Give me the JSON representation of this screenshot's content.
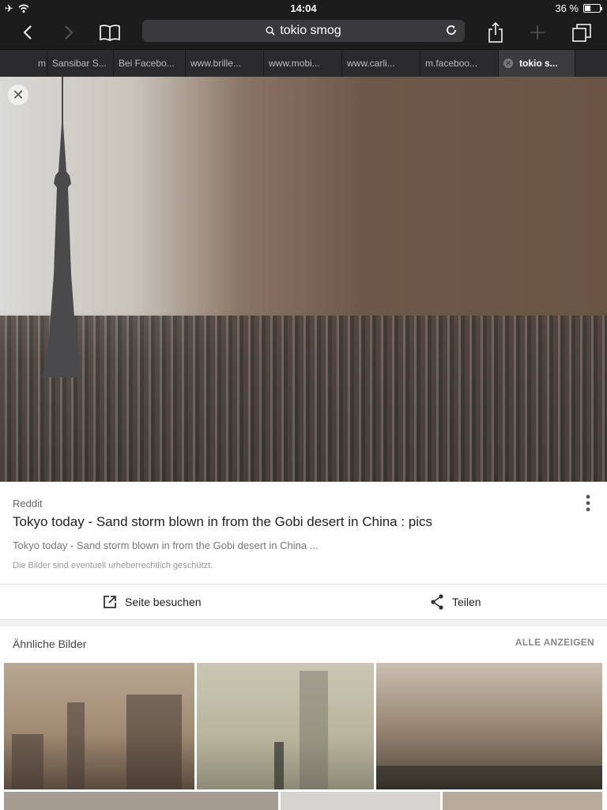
{
  "status": {
    "time": "14:04",
    "battery": "36 %",
    "battery_level": 0.36
  },
  "toolbar": {
    "url_query": "tokio smog"
  },
  "tabs": [
    {
      "label": "m.f"
    },
    {
      "label": "Sansibar S..."
    },
    {
      "label": "Bei Facebo..."
    },
    {
      "label": "www.brille..."
    },
    {
      "label": "www.mobi..."
    },
    {
      "label": "www.carli..."
    },
    {
      "label": "m.faceboo..."
    },
    {
      "label": "tokio s..."
    }
  ],
  "result": {
    "source": "Reddit",
    "title": "Tokyo today - Sand storm blown in from the Gobi desert in China : pics",
    "description": "Tokyo today - Sand storm blown in from the Gobi desert in China ...",
    "copyright": "Die Bilder sind eventuell urheberrechtlich geschützt."
  },
  "actions": {
    "visit_label": "Seite besuchen",
    "share_label": "Teilen"
  },
  "similar": {
    "label": "Ähnliche Bilder",
    "show_all": "ALLE ANZEIGEN"
  },
  "icons": {
    "airplane": "airplane-icon",
    "wifi": "wifi-icon",
    "back": "chevron-left-icon",
    "forward": "chevron-right-icon",
    "bookmarks": "book-icon",
    "search": "search-icon",
    "reload": "reload-icon",
    "share": "share-icon",
    "add": "plus-icon",
    "tabs": "tabs-icon",
    "close": "close-icon",
    "more": "more-vertical-icon",
    "open_external": "external-link-icon",
    "share_nodes": "share-nodes-icon"
  }
}
